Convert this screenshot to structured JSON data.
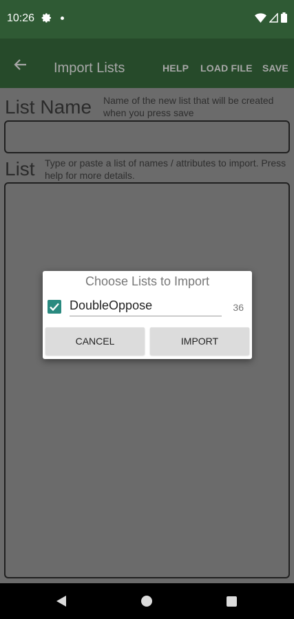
{
  "status_bar": {
    "time": "10:26",
    "icons": [
      "settings-icon",
      "notification-dot-icon",
      "wifi-icon",
      "signal-icon",
      "battery-icon"
    ]
  },
  "app_bar": {
    "title": "Import Lists",
    "actions": {
      "help": "HELP",
      "load_file": "LOAD FILE",
      "save": "SAVE"
    }
  },
  "form": {
    "list_name_label": "List Name",
    "list_name_hint": "Name of the new list that will be created when you press save",
    "list_name_value": "",
    "list_label": "List",
    "list_hint": "Type or paste a list of names / attributes to import. Press help for more details.",
    "list_value": ""
  },
  "dialog": {
    "title": "Choose Lists to Import",
    "items": [
      {
        "label": "DoubleOppose",
        "count": "36",
        "checked": true
      }
    ],
    "cancel_label": "CANCEL",
    "import_label": "IMPORT"
  },
  "colors": {
    "status_bar": "#2f5a34",
    "app_bar": "#264a2a",
    "scrim_background": "#6b6b6b",
    "checkbox_accent": "#2a8a80",
    "dialog_button": "#dcdcdc"
  }
}
